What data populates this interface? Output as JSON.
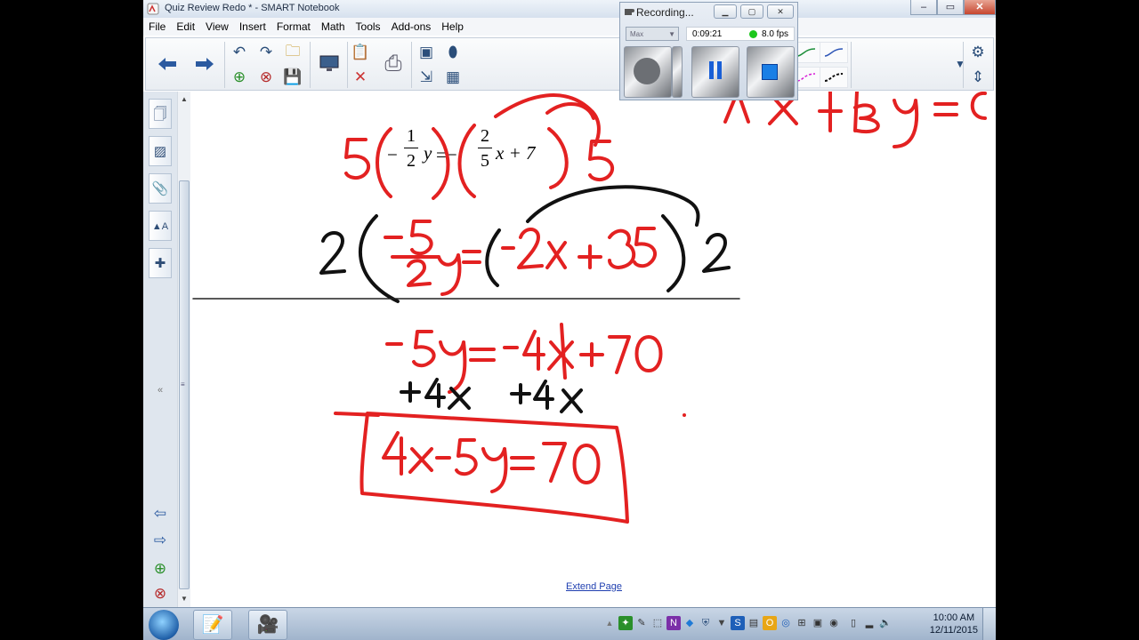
{
  "window": {
    "title": "Quiz Review Redo * - SMART Notebook"
  },
  "menu": [
    "File",
    "Edit",
    "View",
    "Insert",
    "Format",
    "Math",
    "Tools",
    "Add-ons",
    "Help"
  ],
  "recorder": {
    "title": "Recording...",
    "mode": "Max",
    "elapsed": "0:09:21",
    "fps": "8.0 fps",
    "status_color": "#1cc71c"
  },
  "canvas": {
    "typed_equation": {
      "lead": "−",
      "y": "y",
      "eq": "=−",
      "rest": "x + 7",
      "f1_num": "1",
      "f1_den": "2",
      "f2_num": "2",
      "f2_den": "5"
    },
    "handwriting": [
      "5(−½y = −⅖x + 7)5",
      "Ax+By=C",
      "2(−5/2 y = −2x + 35)2",
      "−5y = −4x + 70",
      "+4x",
      "+4x",
      "4x−5y=70"
    ],
    "ink_colors": {
      "red": "#e32121",
      "black": "#111111"
    },
    "extend_page": "Extend Page"
  },
  "taskbar": {
    "time": "10:00 AM",
    "date": "12/11/2015"
  },
  "icons": {
    "toolbar": [
      "back-arrow-icon",
      "forward-arrow-icon",
      "undo-icon",
      "redo-icon",
      "open-folder-icon",
      "add-page-icon",
      "delete-page-icon",
      "save-icon",
      "screen-shade-icon",
      "paste-icon",
      "delete-icon",
      "capture-icon",
      "table-icon",
      "fill-icon",
      "eraser-icon",
      "pen-icon",
      "settings-icon"
    ],
    "pen_colors": [
      "#222222",
      "#1d6fb8",
      "#1d8f3a",
      "#2f57b7",
      "#c22fc2",
      "#e8d11b",
      "#d61bd6",
      "#111111"
    ]
  }
}
